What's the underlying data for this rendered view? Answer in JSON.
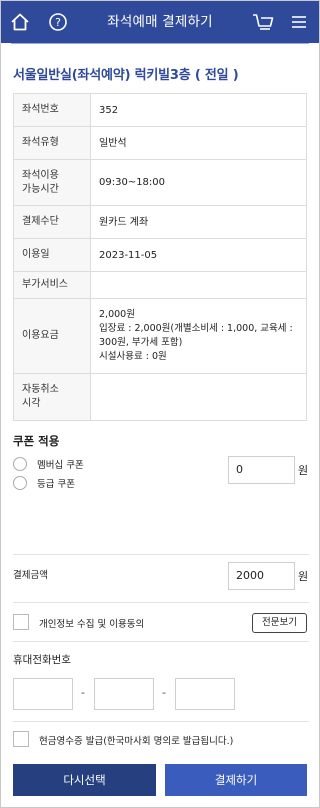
{
  "header": {
    "title": "좌석예매 결제하기"
  },
  "venue": "서울일반실(좌석예약) 럭키빌3층 ( 전일 )",
  "info_rows": [
    {
      "key": "좌석번호",
      "value": "352"
    },
    {
      "key": "좌석유형",
      "value": "일반석"
    },
    {
      "key": "좌석이용\n가능시간",
      "value": "09:30~18:00"
    },
    {
      "key": "결제수단",
      "value": "원카드 계좌"
    },
    {
      "key": "이용일",
      "value": "2023-11-05"
    },
    {
      "key": "부가서비스",
      "value": ""
    },
    {
      "key": "이용요금",
      "value": "2,000원\n입장료 : 2,000원(개별소비세 : 1,000, 교육세 : 300원, 부가세 포함)\n시설사용료 : 0원"
    },
    {
      "key": "자동취소\n시각",
      "value": ""
    }
  ],
  "coupon": {
    "title": "쿠폰 적용",
    "options": [
      "멤버십 쿠폰",
      "등급 쿠폰"
    ],
    "amount": "0",
    "unit": "원"
  },
  "payment": {
    "label": "결제금액",
    "amount": "2000",
    "unit": "원"
  },
  "privacy": {
    "label": "개인정보 수집 및 이용동의",
    "view_button": "전문보기"
  },
  "phone": {
    "label": "휴대전화번호",
    "separator": "-"
  },
  "receipt": {
    "label": "현금영수증 발급(한국마사회 명의로 발급됩니다.)"
  },
  "buttons": {
    "reselect": "다시선택",
    "pay": "결제하기"
  },
  "colors": {
    "header": "#2f4a9a",
    "venue_text": "#2f4a9a",
    "reselect_button": "#263f7e",
    "pay_button": "#3a5cbc"
  },
  "icons": [
    "home-icon",
    "help-icon",
    "cart-icon",
    "menu-icon"
  ]
}
